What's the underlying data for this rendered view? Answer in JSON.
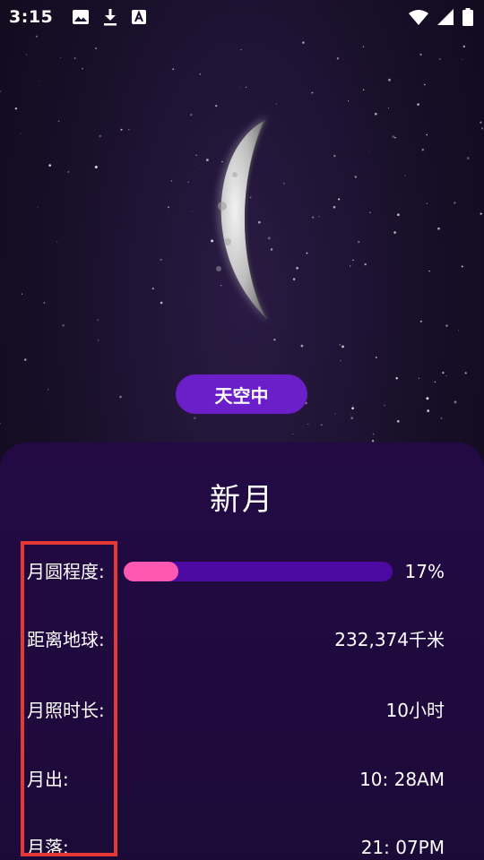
{
  "status_bar": {
    "time": "3:15",
    "icons_left": [
      "image-icon",
      "download-icon",
      "font-a-icon"
    ],
    "icons_right": [
      "wifi-icon",
      "signal-icon",
      "battery-icon"
    ]
  },
  "sky_button": {
    "label": "天空中"
  },
  "phase": {
    "title": "新月"
  },
  "details": {
    "illumination": {
      "label": "月圆程度:",
      "value": "17%",
      "fraction": 0.17
    },
    "distance": {
      "label": "距离地球:",
      "value": "232,374千米"
    },
    "duration": {
      "label": "月照时长:",
      "value": "10小时"
    },
    "moonrise": {
      "label": "月出:",
      "value": "10: 28AM"
    },
    "moonset": {
      "label": "月落:",
      "value": "21: 07PM"
    }
  },
  "colors": {
    "accent_purple": "#6a1fc9",
    "bar_track": "#4d0aa3",
    "bar_fill": "#ff58b0",
    "highlight_red": "#e53935"
  }
}
